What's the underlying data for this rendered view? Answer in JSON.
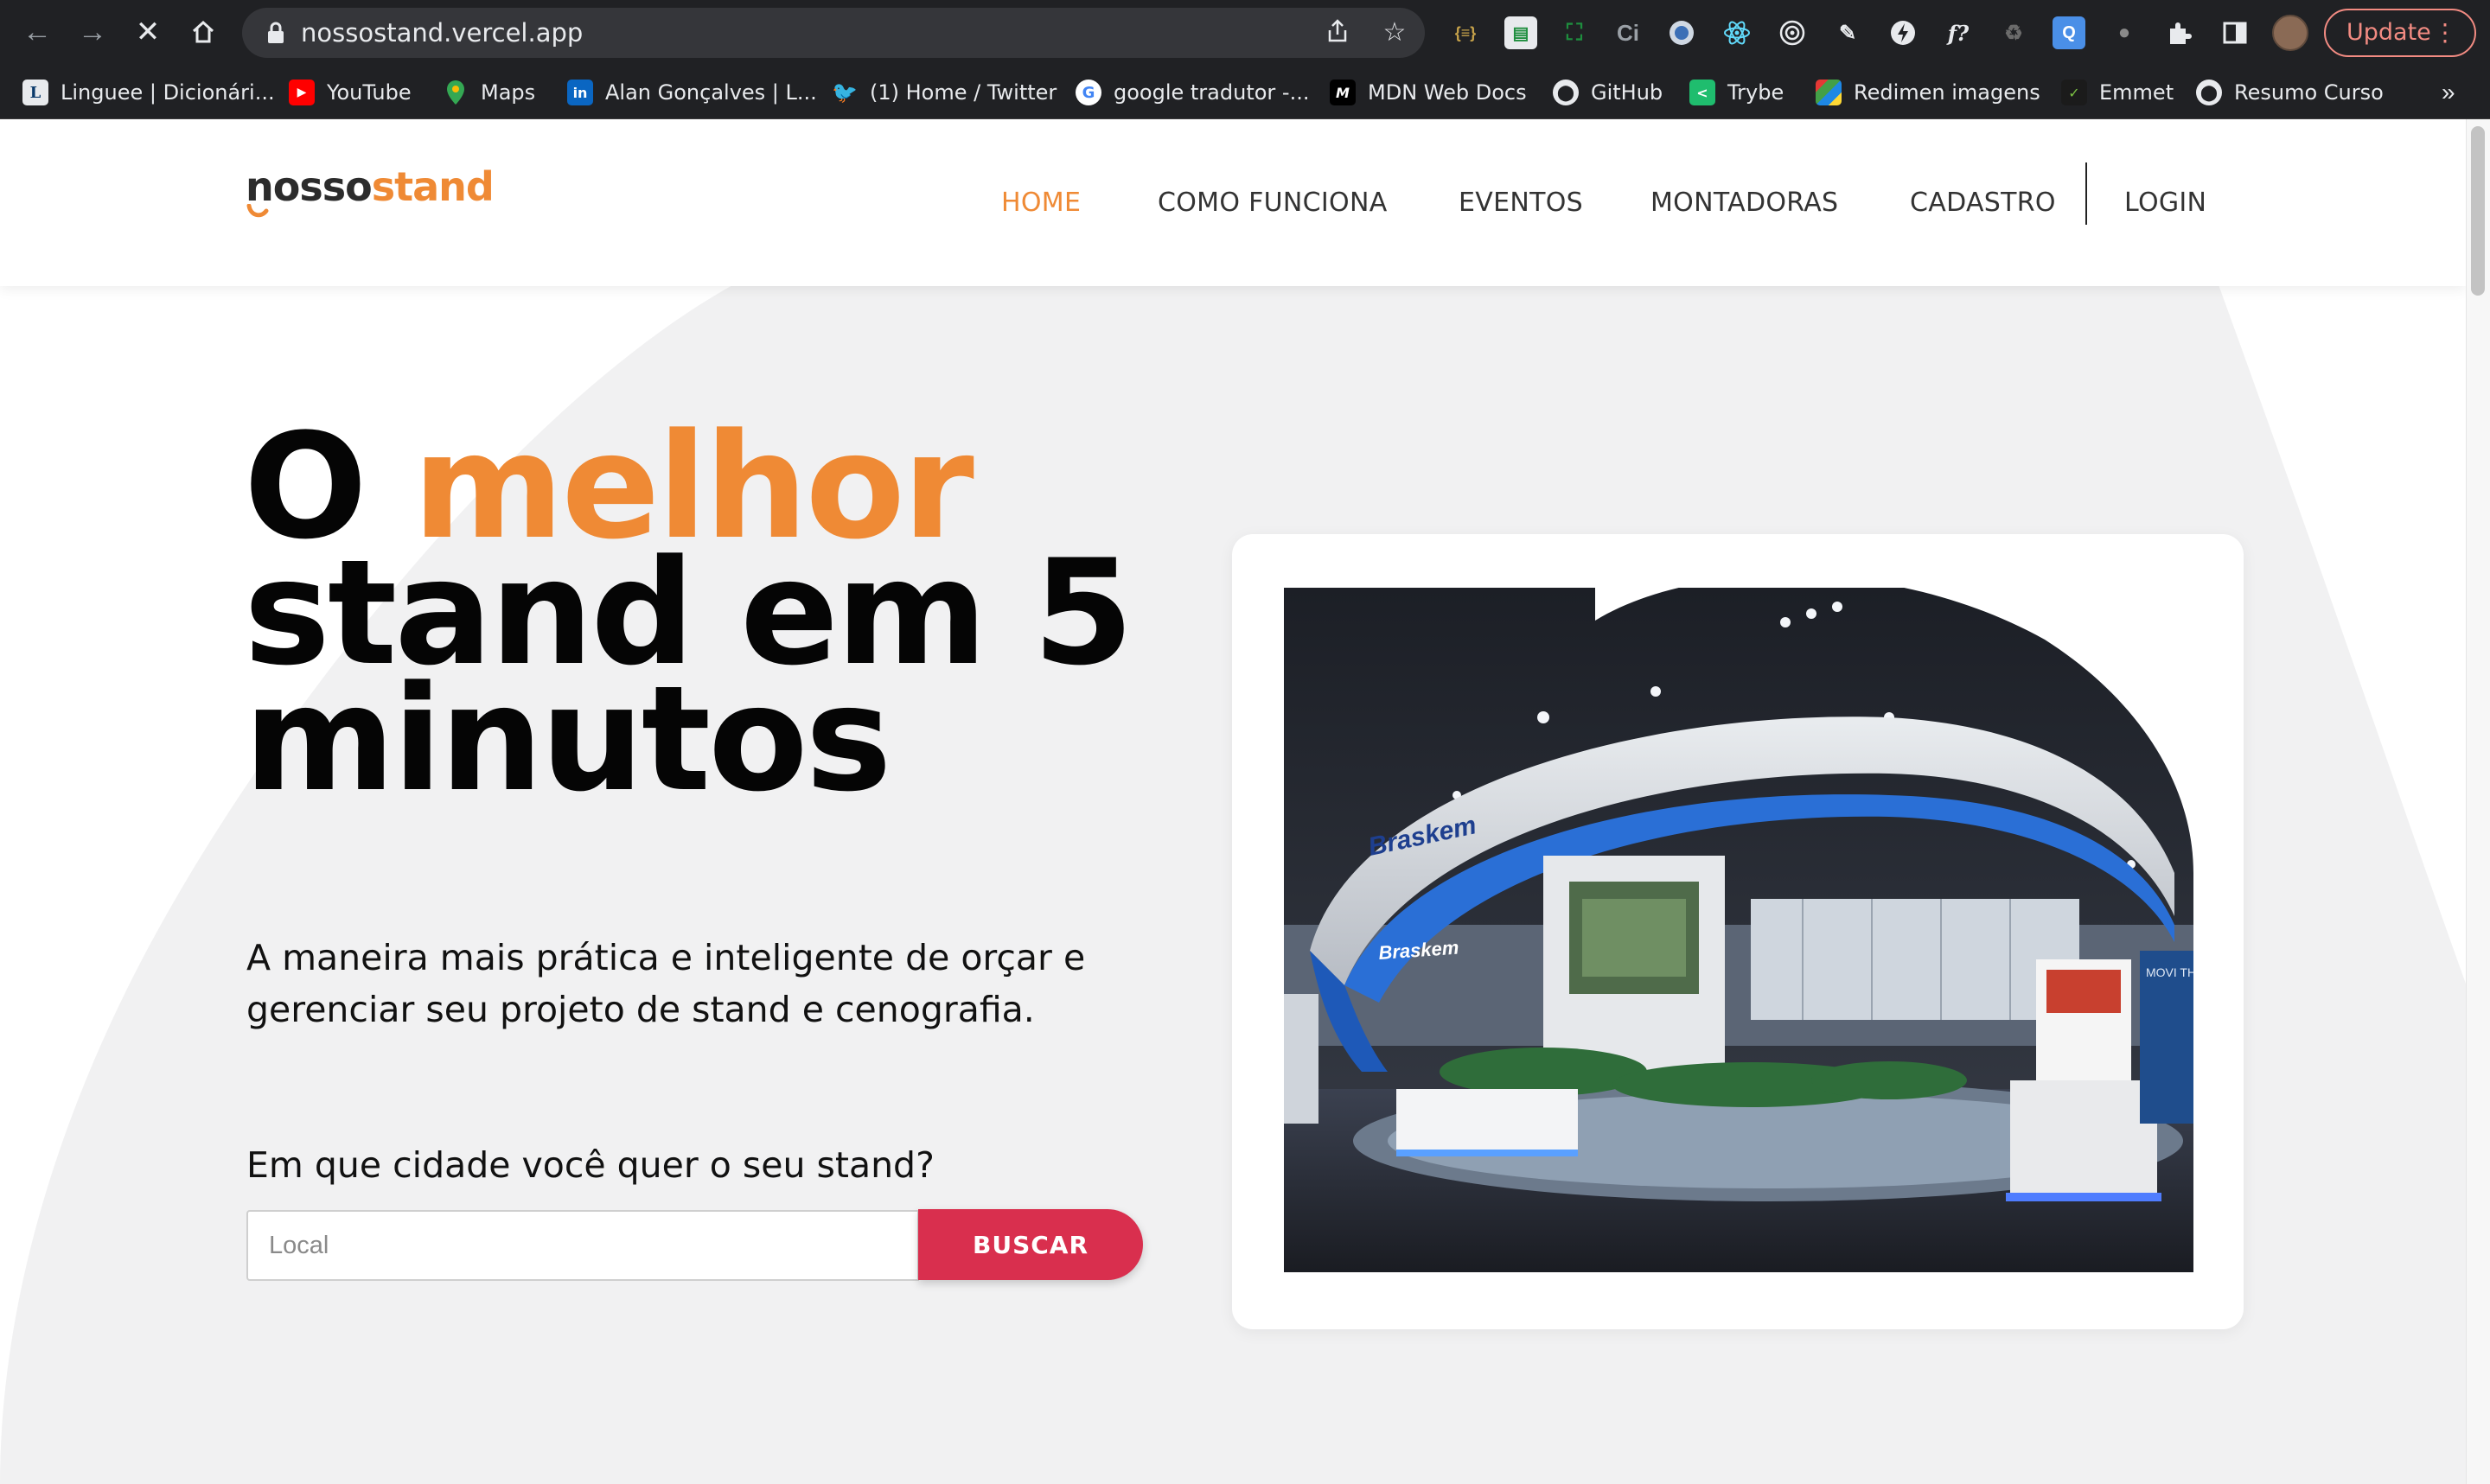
{
  "browser": {
    "url": "nossostand.vercel.app",
    "update_label": "Update",
    "bookmarks": [
      {
        "label": "Linguee | Dicionári...",
        "icon": "linguee-icon"
      },
      {
        "label": "YouTube",
        "icon": "youtube-icon"
      },
      {
        "label": "Maps",
        "icon": "maps-icon"
      },
      {
        "label": "Alan Gonçalves | L...",
        "icon": "linkedin-icon"
      },
      {
        "label": "(1) Home / Twitter",
        "icon": "twitter-icon"
      },
      {
        "label": "google tradutor -...",
        "icon": "google-icon"
      },
      {
        "label": "MDN Web Docs",
        "icon": "mdn-icon"
      },
      {
        "label": "GitHub",
        "icon": "github-icon"
      },
      {
        "label": "Trybe",
        "icon": "trybe-icon"
      },
      {
        "label": "Redimen imagens",
        "icon": "grid-icon"
      },
      {
        "label": "Emmet",
        "icon": "emmet-icon"
      },
      {
        "label": "Resumo Curso",
        "icon": "github-icon"
      }
    ]
  },
  "site": {
    "logo_part1": "nosso",
    "logo_part2": "stand",
    "nav": [
      "HOME",
      "COMO FUNCIONA",
      "EVENTOS",
      "MONTADORAS",
      "CADASTRO",
      "LOGIN"
    ],
    "active_nav": "HOME",
    "hero": {
      "title_word1": "O ",
      "title_accent": "melhor",
      "title_rest": "stand em 5 minutos",
      "subtitle": "A maneira mais prática e inteligente de orçar e gerenciar seu projeto de stand e cenografia.",
      "question": "Em que cidade você quer o seu stand?",
      "search_placeholder": "Local",
      "search_button": "BUSCAR"
    },
    "photo_text": {
      "brand": "Braskem",
      "screen_text": "MOVI THE W FORW"
    }
  },
  "colors": {
    "accent_orange": "#ef8a35",
    "button_red": "#d92f4e",
    "chrome_dark": "#202124"
  }
}
